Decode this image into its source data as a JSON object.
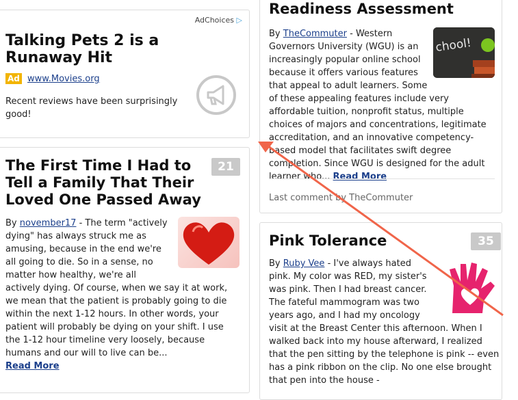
{
  "ad": {
    "adchoices": "AdChoices",
    "title": "Talking Pets 2 is a Runaway Hit",
    "tag": "Ad",
    "url": "www.Movies.org",
    "text": "Recent reviews have been surprisingly good!",
    "icon": "megaphone-icon"
  },
  "left_article": {
    "title": "The First Time I Had to Tell a Family That Their Loved One Passed Away",
    "count": "21",
    "by": "By",
    "author": "november17",
    "text_top": "- The term \"actively dying\" has always struck me as amusing, because in the end we're all going to die. So in a sense, no matter how healthy,",
    "text_rest": "we're all actively dying. Of course, when we say it at work, we mean that the patient is probably going to die within the next 1-12 hours. In other words, your patient will probably be dying on your shift. I use the 1-12 hour timeline very loosely, because humans and our will to live can be...",
    "read_more": "Read More",
    "image": "red-heart-image"
  },
  "right_top_article": {
    "title": "Readiness Assessment",
    "by": "By",
    "author": "TheCommuter",
    "text_top": "- Western Governors University (WGU) is an increasingly popular online school because it offers various features that appeal to adult learners.",
    "text_rest": "Some of these appealing features include very affordable tuition, nonprofit status, multiple choices of majors and concentrations, legitimate accreditation, and an innovative competency-based model that facilitates swift degree completion. Since WGU is designed for the adult learner who...",
    "read_more": "Read More",
    "last_comment": "Last comment by TheCommuter",
    "image": "school-chalkboard-image"
  },
  "right_bottom_article": {
    "title": "Pink Tolerance",
    "count": "35",
    "by": "By",
    "author": "Ruby Vee",
    "text_top": "- I've always hated pink. My color was RED, my sister's was pink. Then I had breast cancer. The fateful mammogram was two years ago,",
    "text_rest": "and I had my oncology visit at the Breast Center this afternoon. When I walked back into my house afterward, I realized that the pen sitting by the telephone is pink -- even has a pink ribbon on the clip. No one else brought that pen into the house -",
    "image": "pink-hand-heart-image"
  },
  "annotation": {
    "arrow_color": "#f0654a"
  }
}
